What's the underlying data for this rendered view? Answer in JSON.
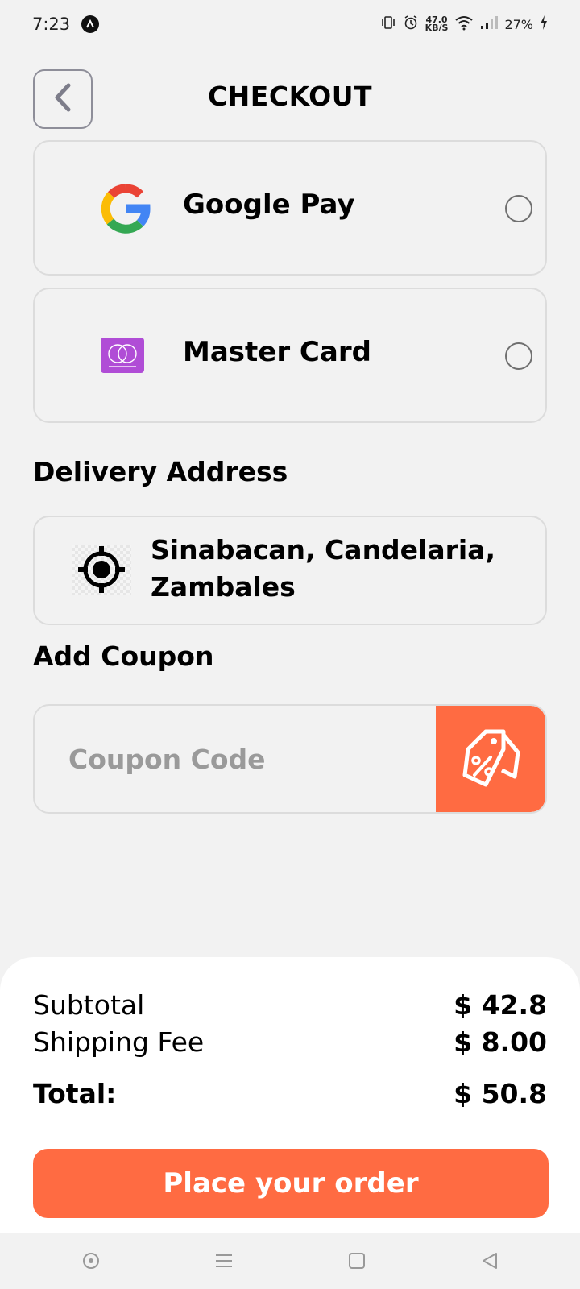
{
  "status_bar": {
    "time": "7:23",
    "net_speed_value": "47.0",
    "net_speed_unit": "KB/S",
    "battery": "27%"
  },
  "header": {
    "title": "CHECKOUT"
  },
  "payment_methods": [
    {
      "label": "Google Pay",
      "icon": "google-logo-icon",
      "selected": false
    },
    {
      "label": "Master Card",
      "icon": "mastercard-icon",
      "selected": false
    }
  ],
  "delivery": {
    "title": "Delivery Address",
    "address": "Sinabacan, Candelaria, Zambales",
    "icon": "location-target-icon"
  },
  "coupon": {
    "title": "Add Coupon",
    "placeholder": "Coupon Code",
    "icon": "discount-tag-icon"
  },
  "summary": {
    "subtotal_label": "Subtotal",
    "subtotal_value": "$ 42.8",
    "shipping_label": "Shipping Fee",
    "shipping_value": "$ 8.00",
    "total_label": "Total:",
    "total_value": "$ 50.8",
    "order_button": "Place your order"
  },
  "colors": {
    "accent": "#ff6b42",
    "background": "#f2f2f2",
    "card_border": "#dcdcdc"
  }
}
